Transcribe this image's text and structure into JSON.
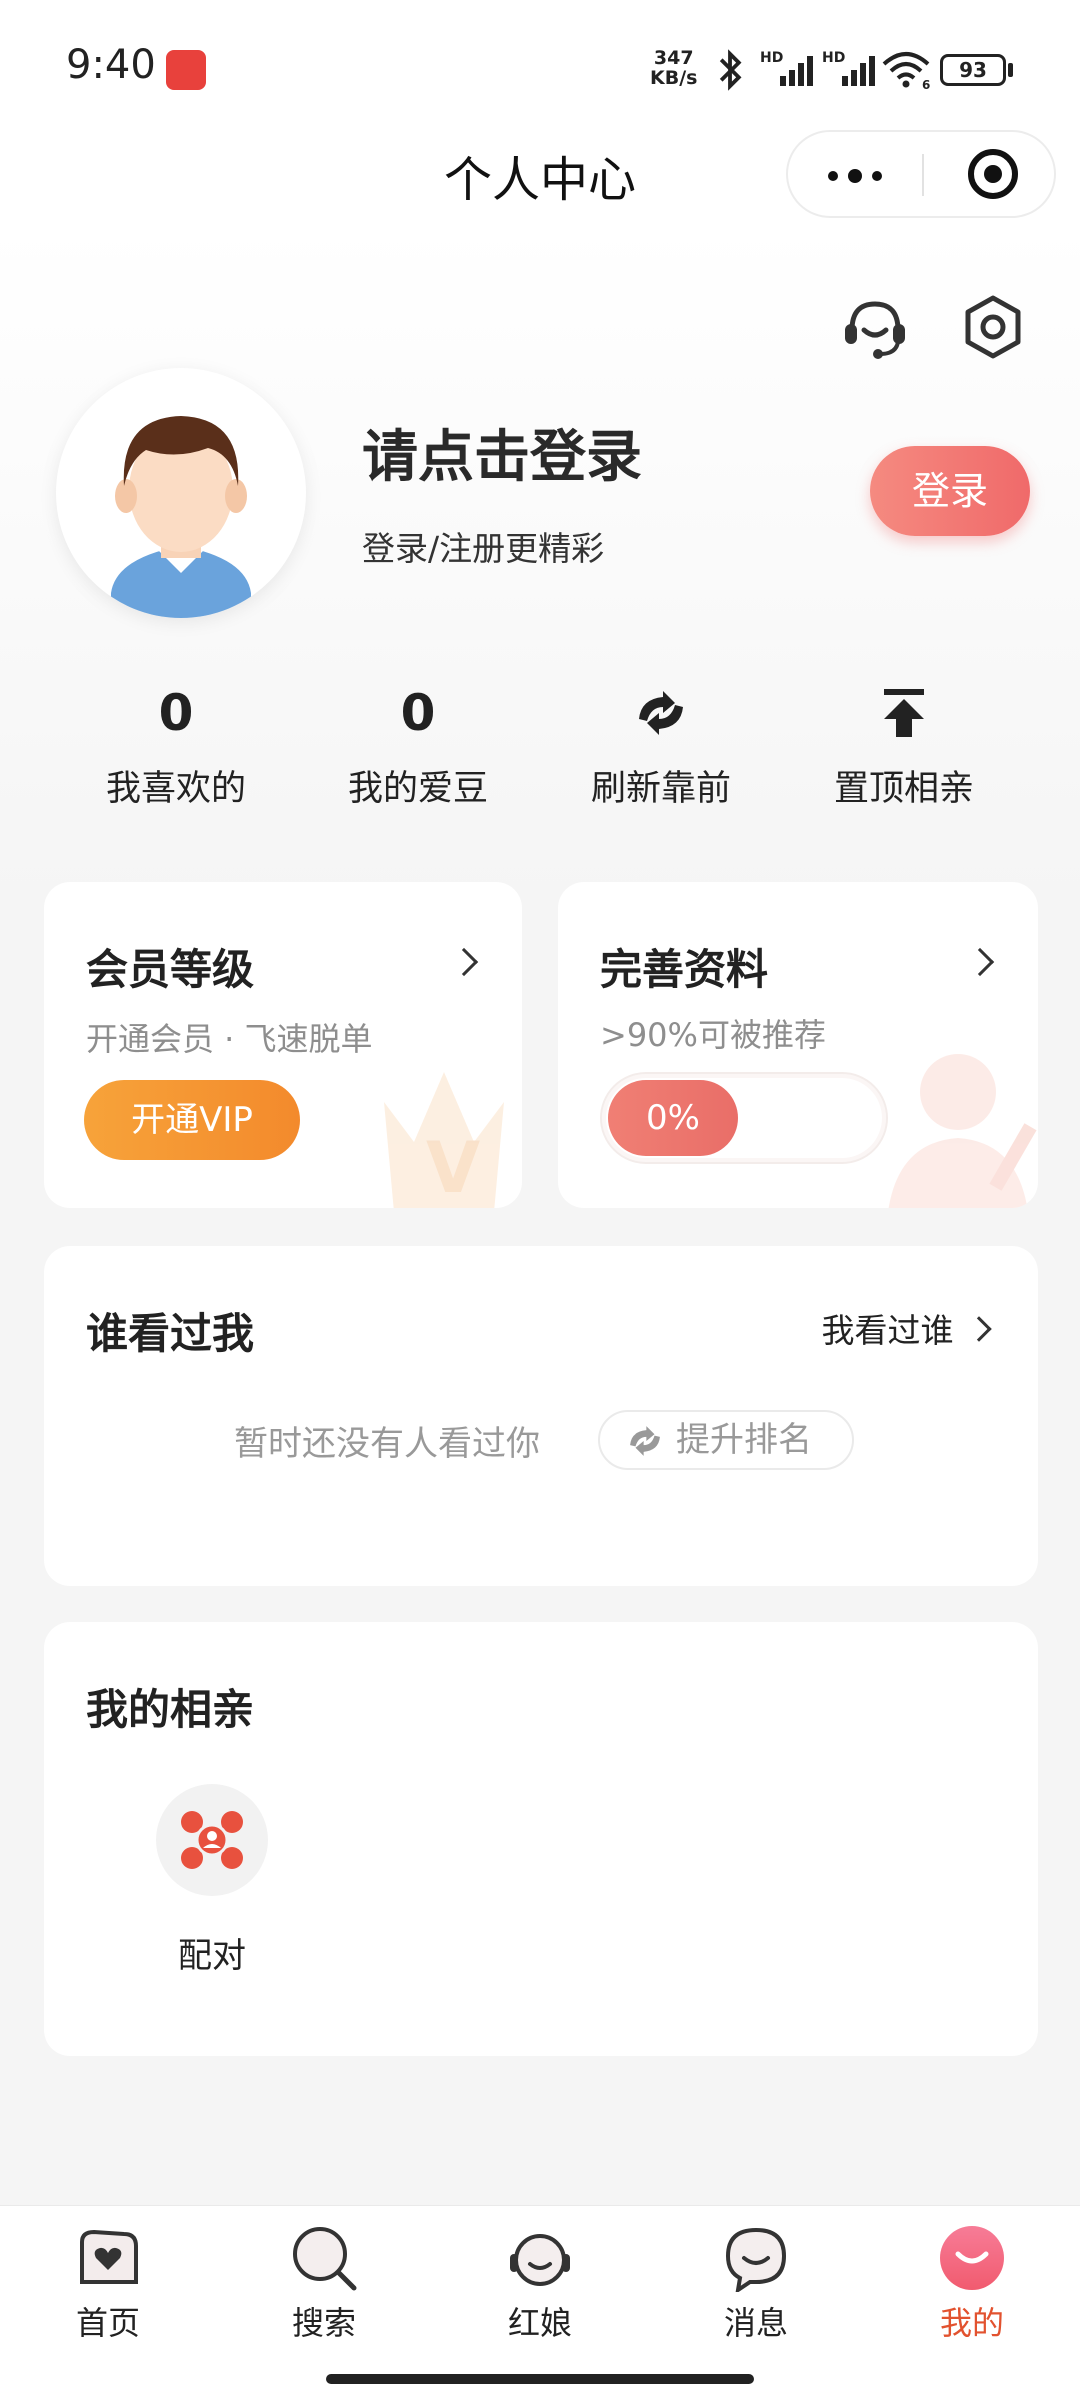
{
  "status_bar": {
    "time": "9:40",
    "net_speed_value": "347",
    "net_speed_unit": "KB/s",
    "hd_label": "HD",
    "wifi_sub": "6",
    "battery": "93"
  },
  "nav": {
    "title": "个人中心"
  },
  "profile": {
    "title": "请点击登录",
    "subtitle": "登录/注册更精彩",
    "login_button": "登录"
  },
  "stats": [
    {
      "value": "0",
      "label": "我喜欢的"
    },
    {
      "value": "0",
      "label": "我的爱豆"
    },
    {
      "icon": "refresh-arrows-icon",
      "label": "刷新靠前"
    },
    {
      "icon": "pin-top-icon",
      "label": "置顶相亲"
    }
  ],
  "member_card": {
    "title": "会员等级",
    "subtitle": "开通会员 · 飞速脱单",
    "button": "开通VIP"
  },
  "profile_card": {
    "title": "完善资料",
    "subtitle": ">90%可被推荐",
    "progress_label": "0%",
    "progress_value": 0
  },
  "visitors": {
    "title": "谁看过我",
    "link": "我看过谁",
    "empty_text": "暂时还没有人看过你",
    "boost_button": "提升排名"
  },
  "my_dating": {
    "title": "我的相亲",
    "items": [
      {
        "label": "配对",
        "icon": "match-network-icon"
      }
    ]
  },
  "tab_bar": [
    {
      "label": "首页",
      "icon": "home-heart-icon"
    },
    {
      "label": "搜索",
      "icon": "search-icon"
    },
    {
      "label": "红娘",
      "icon": "matchmaker-headset-icon"
    },
    {
      "label": "消息",
      "icon": "message-bubble-icon"
    },
    {
      "label": "我的",
      "icon": "me-smile-icon",
      "active": true
    }
  ],
  "colors": {
    "accent": "#f06a6a",
    "vip": "#f3962f",
    "active_tab": "#e2522f"
  }
}
